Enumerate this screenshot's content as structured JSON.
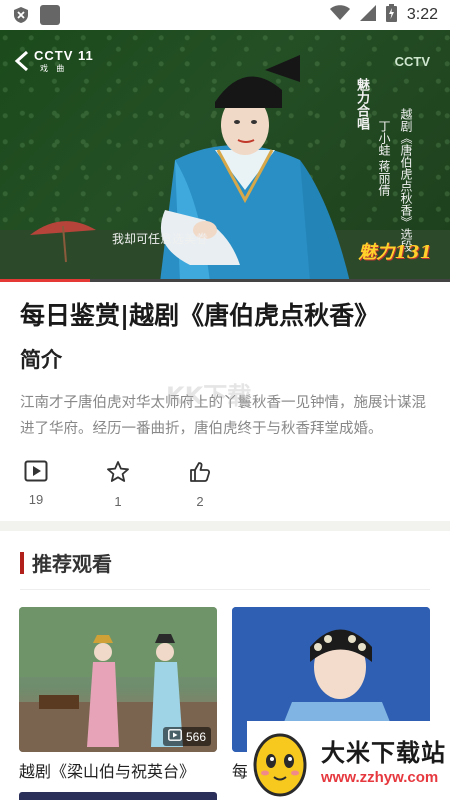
{
  "status_bar": {
    "time": "3:22"
  },
  "video": {
    "logo_text": "CCTV 11",
    "logo_sub": "戏 曲",
    "corner_logo": "CCTV",
    "tag_vertical": "魅力合唱",
    "info_vertical_1": "越剧《唐伯虎点秋香》选段",
    "info_vertical_2": "丁小蛙 蒋丽倩",
    "subtitle": "我却可任意选美眷",
    "badge": "魅力131",
    "progress": 0.2
  },
  "title": "每日鉴赏|越剧《唐伯虎点秋香》",
  "intro_heading": "简介",
  "description": "江南才子唐伯虎对华太师府上的丫鬟秋香一见钟情，施展计谋混进了华府。经历一番曲折，唐伯虎终于与秋香拜堂成婚。",
  "actions": [
    {
      "icon": "play-icon",
      "count": "19"
    },
    {
      "icon": "star-icon",
      "count": "1"
    },
    {
      "icon": "thumbs-up-icon",
      "count": "2"
    }
  ],
  "recommend": {
    "heading": "推荐观看",
    "cards": [
      {
        "title": "越剧《梁山伯与祝英台》",
        "play_count": "566"
      },
      {
        "title": "每日鉴赏|越剧《唐伯虎点秋香》"
      }
    ]
  },
  "watermark": "KK下载",
  "download_badge": {
    "name": "大米下载站",
    "url": "www.zzhyw.com"
  }
}
